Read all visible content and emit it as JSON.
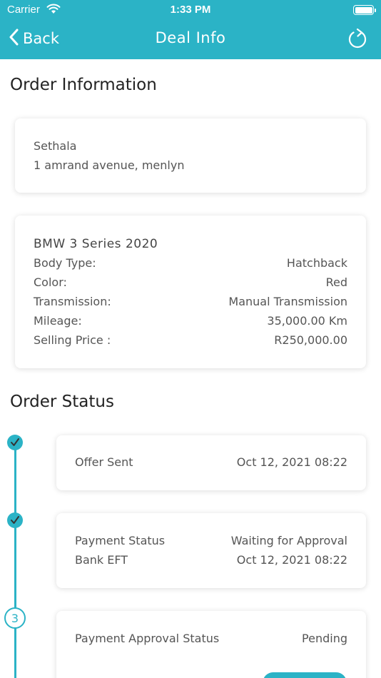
{
  "status_bar": {
    "carrier": "Carrier",
    "time": "1:33 PM"
  },
  "nav": {
    "back_label": "Back",
    "title": "Deal Info"
  },
  "order_information": {
    "title": "Order Information",
    "dealer": {
      "name": "Sethala",
      "address": "1 amrand avenue, menlyn"
    },
    "vehicle": {
      "name": "BMW 3 Series 2020",
      "rows": [
        {
          "label": "Body Type:",
          "value": "Hatchback"
        },
        {
          "label": "Color:",
          "value": "Red"
        },
        {
          "label": "Transmission:",
          "value": "Manual Transmission"
        },
        {
          "label": "Mileage:",
          "value": "35,000.00 Km"
        },
        {
          "label": "Selling Price :",
          "value": "R250,000.00"
        }
      ]
    }
  },
  "order_status": {
    "title": "Order Status",
    "steps": [
      {
        "label": "Offer Sent",
        "value": "Oct 12, 2021 08:22"
      },
      {
        "label": "Payment Status",
        "value": "Waiting for Approval",
        "sub_label": "Bank EFT",
        "sub_value": "Oct 12, 2021 08:22"
      },
      {
        "step_number": "3",
        "label": "Payment Approval Status",
        "value": "Pending"
      }
    ]
  },
  "colors": {
    "accent": "#2bb3c6",
    "background": "#ffffff",
    "text": "#555555"
  }
}
